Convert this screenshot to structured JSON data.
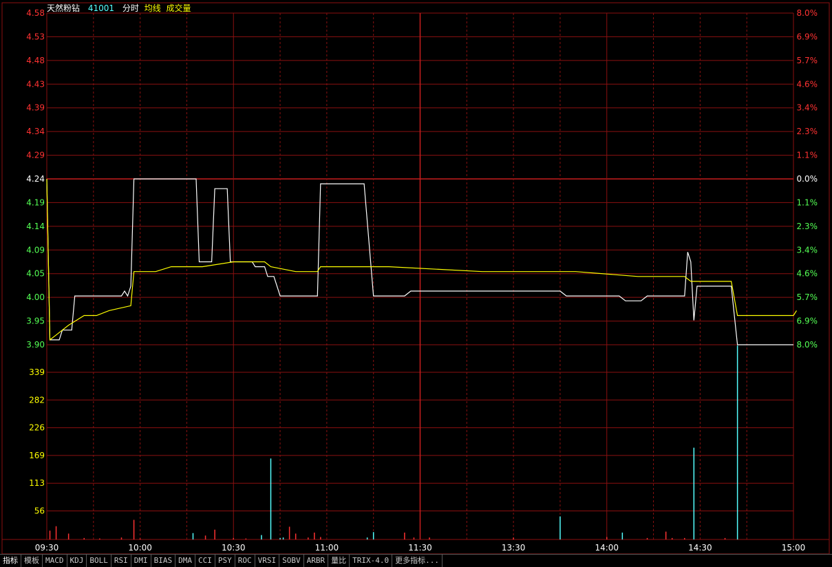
{
  "header": {
    "name": "天然粉钻",
    "code": "41001",
    "mode": "分时",
    "avg_label": "均线",
    "vol_label": "成交量"
  },
  "colors": {
    "up": "#ff3232",
    "down": "#54ff54",
    "grid": "#8b1010",
    "price_line": "#ffffff",
    "avg_line": "#ffff00",
    "volume": "#54ffff",
    "axis_text": "#ffffff"
  },
  "chart_data": {
    "type": "line",
    "subtype": "intraday-timeshare",
    "base_price": 4.24,
    "price_axis_ticks": [
      "4.58",
      "4.53",
      "4.48",
      "4.43",
      "4.39",
      "4.34",
      "4.29",
      "4.24",
      "4.19",
      "4.14",
      "4.09",
      "4.05",
      "4.00",
      "3.95",
      "3.90"
    ],
    "percent_axis_ticks": [
      "8.0%",
      "6.9%",
      "5.7%",
      "4.6%",
      "3.4%",
      "2.3%",
      "1.1%",
      "0.0%",
      "1.1%",
      "2.3%",
      "3.4%",
      "4.6%",
      "5.7%",
      "6.9%",
      "8.0%"
    ],
    "ylim": [
      3.9,
      4.58
    ],
    "x_ticks": [
      "09:30",
      "10:00",
      "10:30",
      "11:00",
      "11:30",
      "13:30",
      "14:00",
      "14:30",
      "15:00"
    ],
    "x_range_minutes": [
      0,
      240
    ],
    "volume_axis_ticks": [
      "339",
      "282",
      "226",
      "169",
      "113",
      "56"
    ],
    "volume_max": 395,
    "series": [
      {
        "role": "price",
        "points": [
          [
            0,
            4.24
          ],
          [
            1,
            3.91
          ],
          [
            4,
            3.91
          ],
          [
            5,
            3.93
          ],
          [
            8,
            3.93
          ],
          [
            9,
            4.0
          ],
          [
            24,
            4.0
          ],
          [
            25,
            4.01
          ],
          [
            26,
            4.0
          ],
          [
            27,
            4.02
          ],
          [
            28,
            4.24
          ],
          [
            48,
            4.24
          ],
          [
            49,
            4.07
          ],
          [
            53,
            4.07
          ],
          [
            54,
            4.22
          ],
          [
            58,
            4.22
          ],
          [
            59,
            4.07
          ],
          [
            66,
            4.07
          ],
          [
            67,
            4.06
          ],
          [
            70,
            4.06
          ],
          [
            71,
            4.04
          ],
          [
            73,
            4.04
          ],
          [
            75,
            4.0
          ],
          [
            87,
            4.0
          ],
          [
            88,
            4.23
          ],
          [
            102,
            4.23
          ],
          [
            105,
            4.0
          ],
          [
            115,
            4.0
          ],
          [
            117,
            4.01
          ],
          [
            165,
            4.01
          ],
          [
            167,
            4.0
          ],
          [
            184,
            4.0
          ],
          [
            186,
            3.99
          ],
          [
            191,
            3.99
          ],
          [
            193,
            4.0
          ],
          [
            205,
            4.0
          ],
          [
            206,
            4.09
          ],
          [
            207,
            4.07
          ],
          [
            208,
            3.95
          ],
          [
            209,
            4.02
          ],
          [
            220,
            4.02
          ],
          [
            222,
            3.9
          ],
          [
            240,
            3.9
          ]
        ]
      },
      {
        "role": "average",
        "points": [
          [
            0,
            4.24
          ],
          [
            1,
            3.91
          ],
          [
            3,
            3.92
          ],
          [
            7,
            3.94
          ],
          [
            12,
            3.96
          ],
          [
            16,
            3.96
          ],
          [
            20,
            3.97
          ],
          [
            27,
            3.98
          ],
          [
            28,
            4.05
          ],
          [
            35,
            4.05
          ],
          [
            40,
            4.06
          ],
          [
            50,
            4.06
          ],
          [
            60,
            4.07
          ],
          [
            70,
            4.07
          ],
          [
            72,
            4.06
          ],
          [
            80,
            4.05
          ],
          [
            87,
            4.05
          ],
          [
            88,
            4.06
          ],
          [
            100,
            4.06
          ],
          [
            110,
            4.06
          ],
          [
            140,
            4.05
          ],
          [
            165,
            4.05
          ],
          [
            170,
            4.05
          ],
          [
            190,
            4.04
          ],
          [
            205,
            4.04
          ],
          [
            207,
            4.03
          ],
          [
            220,
            4.03
          ],
          [
            222,
            3.96
          ],
          [
            240,
            3.96
          ],
          [
            241,
            3.97
          ]
        ]
      }
    ],
    "volume_bars": [
      {
        "t": 1,
        "v": 18,
        "c": "up"
      },
      {
        "t": 3,
        "v": 27,
        "c": "up"
      },
      {
        "t": 7,
        "v": 12,
        "c": "up"
      },
      {
        "t": 12,
        "v": 3,
        "c": "up"
      },
      {
        "t": 17,
        "v": 2,
        "c": "up"
      },
      {
        "t": 24,
        "v": 4,
        "c": "up"
      },
      {
        "t": 28,
        "v": 40,
        "c": "up"
      },
      {
        "t": 30,
        "v": 2,
        "c": "up"
      },
      {
        "t": 47,
        "v": 13,
        "c": "volume"
      },
      {
        "t": 51,
        "v": 8,
        "c": "up"
      },
      {
        "t": 54,
        "v": 20,
        "c": "up"
      },
      {
        "t": 60,
        "v": 3,
        "c": "up"
      },
      {
        "t": 64,
        "v": 2,
        "c": "up"
      },
      {
        "t": 69,
        "v": 9,
        "c": "volume"
      },
      {
        "t": 72,
        "v": 165,
        "c": "volume"
      },
      {
        "t": 75,
        "v": 3,
        "c": "volume"
      },
      {
        "t": 76,
        "v": 4,
        "c": "volume"
      },
      {
        "t": 78,
        "v": 26,
        "c": "up"
      },
      {
        "t": 80,
        "v": 12,
        "c": "up"
      },
      {
        "t": 84,
        "v": 4,
        "c": "up"
      },
      {
        "t": 86,
        "v": 14,
        "c": "up"
      },
      {
        "t": 88,
        "v": 5,
        "c": "up"
      },
      {
        "t": 103,
        "v": 4,
        "c": "volume"
      },
      {
        "t": 105,
        "v": 15,
        "c": "volume"
      },
      {
        "t": 115,
        "v": 14,
        "c": "up"
      },
      {
        "t": 118,
        "v": 4,
        "c": "up"
      },
      {
        "t": 123,
        "v": 4,
        "c": "up"
      },
      {
        "t": 150,
        "v": 4,
        "c": "up"
      },
      {
        "t": 165,
        "v": 47,
        "c": "volume"
      },
      {
        "t": 180,
        "v": 5,
        "c": "up"
      },
      {
        "t": 185,
        "v": 14,
        "c": "volume"
      },
      {
        "t": 193,
        "v": 3,
        "c": "up"
      },
      {
        "t": 199,
        "v": 16,
        "c": "up"
      },
      {
        "t": 201,
        "v": 3,
        "c": "up"
      },
      {
        "t": 205,
        "v": 3,
        "c": "up"
      },
      {
        "t": 208,
        "v": 187,
        "c": "volume"
      },
      {
        "t": 218,
        "v": 3,
        "c": "up"
      },
      {
        "t": 222,
        "v": 395,
        "c": "volume"
      }
    ]
  },
  "indicator_tabs": [
    "指标",
    "模板",
    "MACD",
    "KDJ",
    "BOLL",
    "RSI",
    "DMI",
    "BIAS",
    "DMA",
    "CCI",
    "PSY",
    "ROC",
    "VRSI",
    "SOBV",
    "ARBR",
    "量比",
    "TRIX-4.0",
    "更多指标..."
  ]
}
